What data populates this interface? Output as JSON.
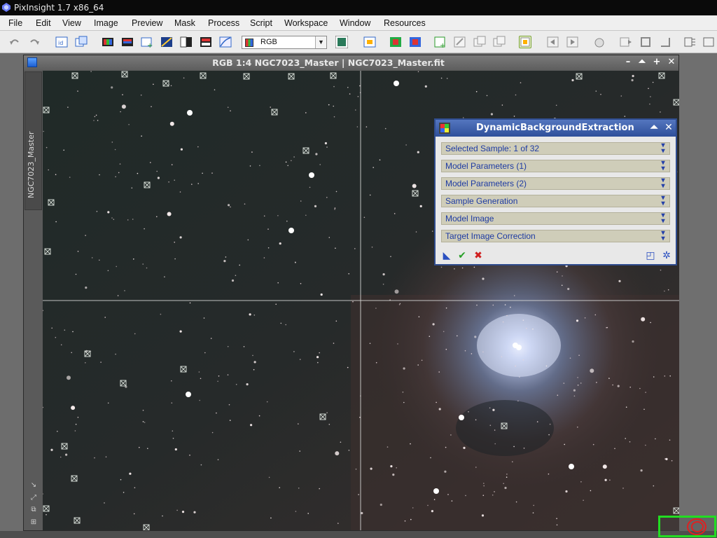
{
  "app": {
    "title": "PixInsight 1.7 x86_64"
  },
  "menu": [
    "File",
    "Edit",
    "View",
    "Image",
    "Preview",
    "Mask",
    "Process",
    "Script",
    "Workspace",
    "Window",
    "Resources"
  ],
  "toolbar": {
    "channel_select_value": "RGB"
  },
  "image_window": {
    "title": "RGB 1:4 NGC7023_Master | NGC7023_Master.fit",
    "side_tab_label": "NGC7023_Master"
  },
  "dbe": {
    "title": "DynamicBackgroundExtraction",
    "sections": [
      "Selected Sample: 1 of 32",
      "Model Parameters (1)",
      "Model Parameters (2)",
      "Sample Generation",
      "Model Image",
      "Target Image Correction"
    ]
  },
  "colors": {
    "dbe_title": "#2e4f9a",
    "section_text": "#1e3ba3",
    "highlight_box": "#22dd22",
    "cursor_ring": "#e02020"
  },
  "icons": [
    "pixinsight-icon",
    "window-icon",
    "minimize-icon",
    "shade-icon",
    "maximize-icon",
    "close-icon",
    "expand-section-icon",
    "apply-global-icon",
    "execute-check-icon",
    "cancel-x-icon",
    "reset-icon",
    "preferences-icon"
  ]
}
